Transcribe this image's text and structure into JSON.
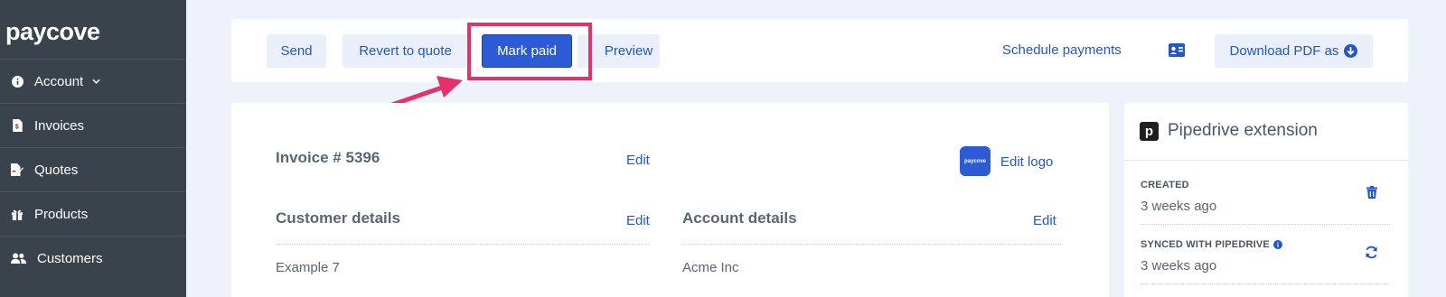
{
  "brand": {
    "name": "paycove",
    "accent": "#2d5bd6",
    "highlight": "#e4306b"
  },
  "sidebar": {
    "items": [
      {
        "label": "Account",
        "icon": "info-circle-icon",
        "has_caret": true
      },
      {
        "label": "Invoices",
        "icon": "invoice-file-icon"
      },
      {
        "label": "Quotes",
        "icon": "quote-signature-icon"
      },
      {
        "label": "Products",
        "icon": "gift-icon"
      },
      {
        "label": "Customers",
        "icon": "users-icon"
      }
    ]
  },
  "toolbar": {
    "send_label": "Send",
    "revert_label": "Revert to quote",
    "mark_paid_label": "Mark paid",
    "preview_label": "Preview",
    "schedule_label": "Schedule payments",
    "contact_card_icon": "contact-card-icon",
    "download_label": "Download PDF as"
  },
  "invoice": {
    "title": "Invoice # 5396",
    "edit_label": "Edit",
    "logo_text": "paycove",
    "edit_logo_label": "Edit logo",
    "customer_title": "Customer details",
    "customer_edit": "Edit",
    "customer_value": "Example 7",
    "account_title": "Account details",
    "account_edit": "Edit",
    "account_value": "Acme Inc"
  },
  "pipedrive": {
    "logo_letter": "p",
    "title": "Pipedrive extension",
    "created_label": "CREATED",
    "created_value": "3 weeks ago",
    "synced_label": "SYNCED WITH PIPEDRIVE",
    "synced_value": "3 weeks ago"
  }
}
